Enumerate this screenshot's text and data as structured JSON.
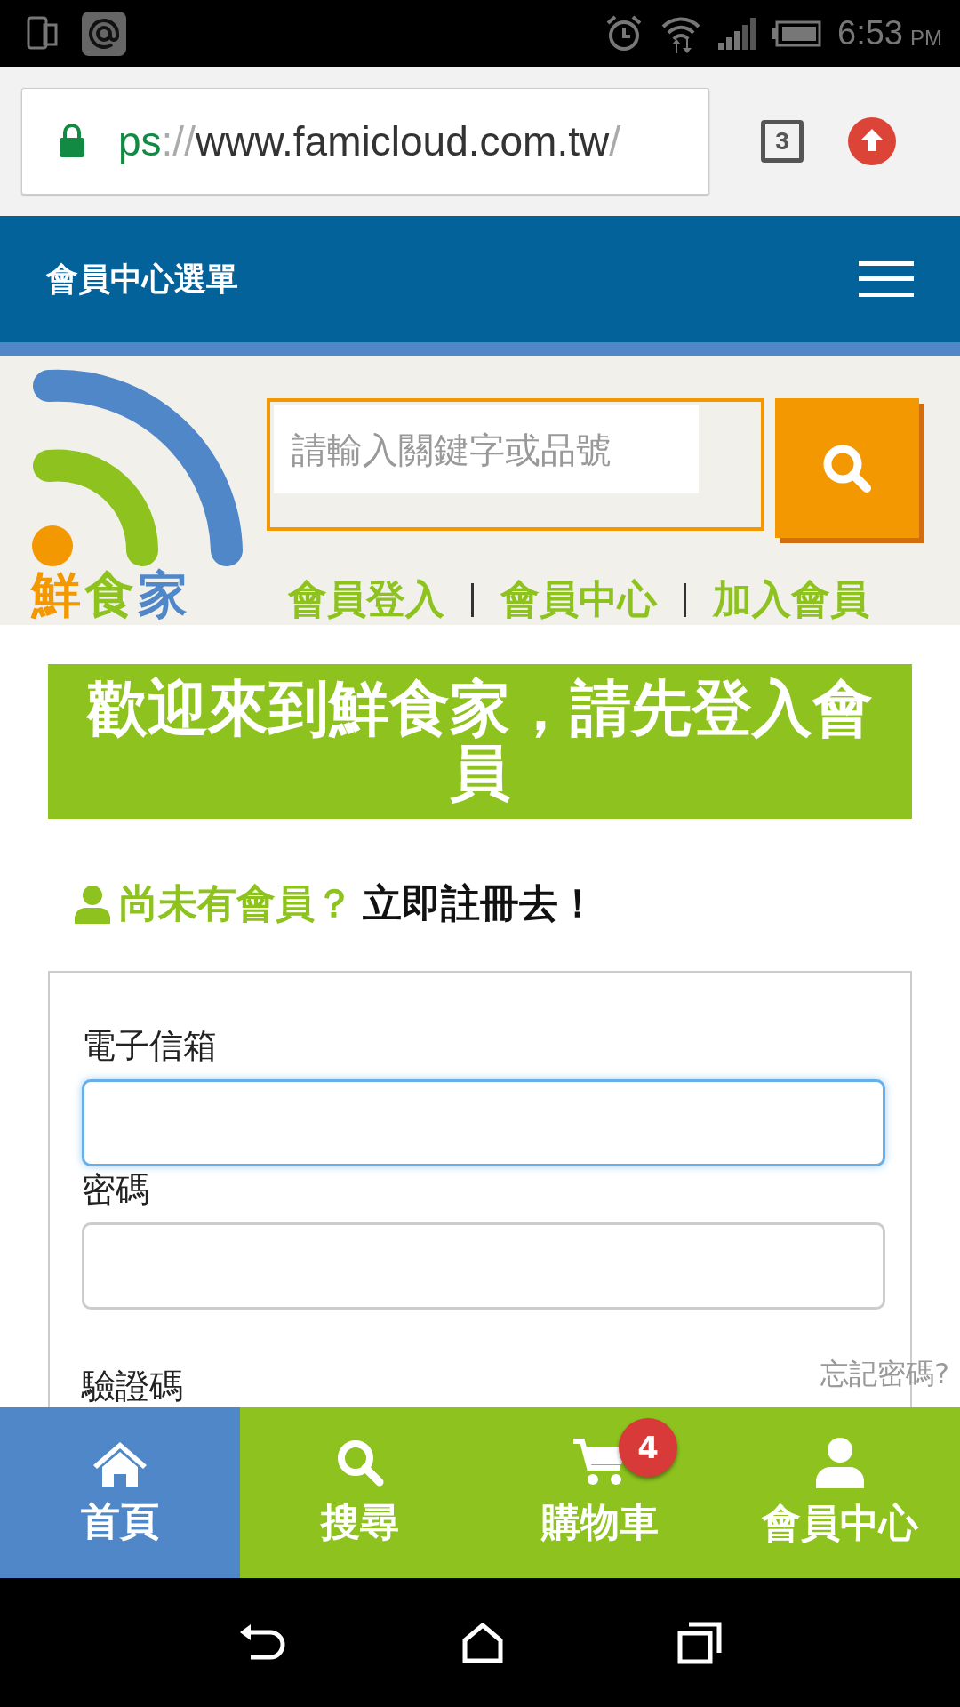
{
  "status_bar": {
    "time": "6:53",
    "ampm": "PM"
  },
  "browser": {
    "url_scheme": "ps",
    "url_sep": "://",
    "url_host": "www.famicloud.com.tw",
    "url_tail": "/",
    "tab_count": "3"
  },
  "header": {
    "title": "會員中心選單"
  },
  "logo": {
    "text": "鮮食家"
  },
  "search": {
    "placeholder": "請輸入關鍵字或品號"
  },
  "links": [
    {
      "label": "會員登入"
    },
    {
      "label": "會員中心"
    },
    {
      "label": "加入會員"
    }
  ],
  "banner": {
    "title": "歡迎來到鮮食家，請先登入會員"
  },
  "register": {
    "prompt": "尚未有會員？",
    "action": "立即註冊去！"
  },
  "form": {
    "fields": [
      {
        "label": "電子信箱",
        "focused": true
      },
      {
        "label": "密碼",
        "focused": false
      }
    ],
    "forgot": "忘記密碼?",
    "captcha_label": "驗證碼"
  },
  "bottom_nav": [
    {
      "kind": "home",
      "label": "首頁",
      "selected": true
    },
    {
      "kind": "search",
      "label": "搜尋",
      "selected": false
    },
    {
      "kind": "cart",
      "label": "購物車",
      "selected": false,
      "badge": "4"
    },
    {
      "kind": "user",
      "label": "會員中心",
      "selected": false
    }
  ]
}
